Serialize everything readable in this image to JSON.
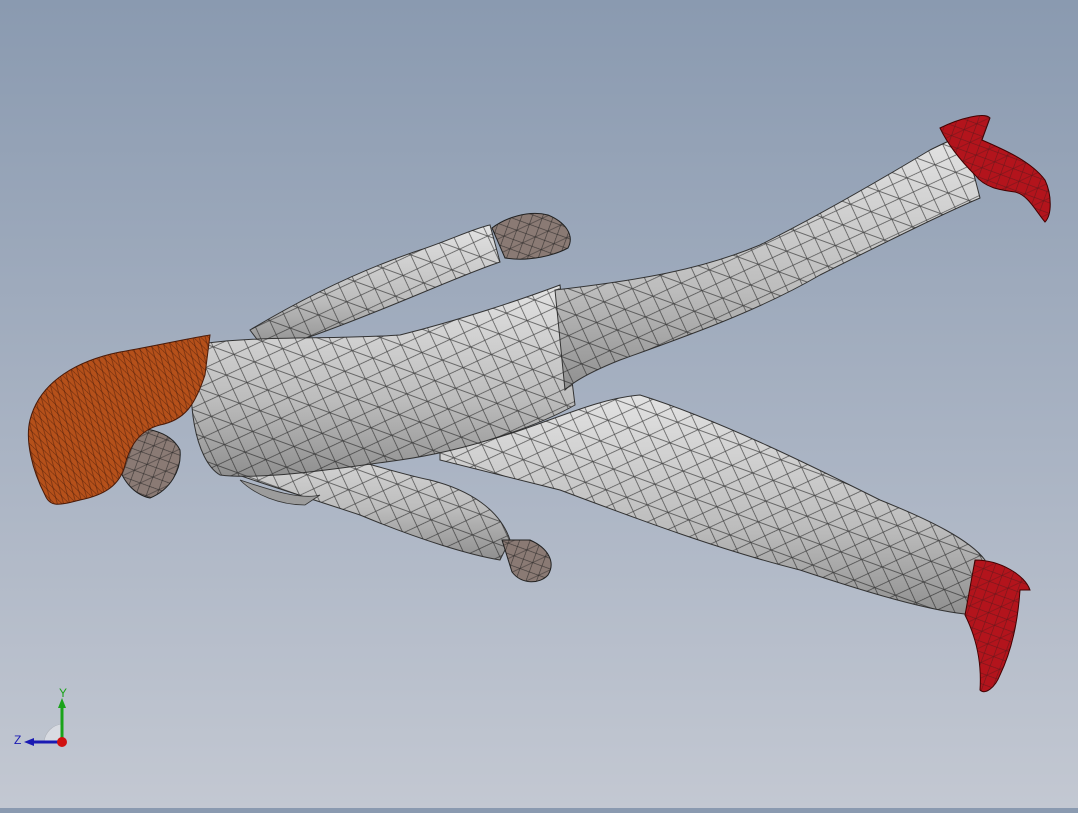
{
  "viewport": {
    "background_top": "#8a9ab0",
    "background_bottom": "#c3c8d2",
    "model": "mannequin-mesh"
  },
  "colors": {
    "suit": "#c9c9c9",
    "suit_shade": "#9c9c9c",
    "hair": "#b5501a",
    "hair_shade": "#8a3a10",
    "skin": "#8a7a74",
    "shoe": "#b3141c",
    "mesh": "#1c1c1c"
  },
  "triad": {
    "y_label": "Y",
    "z_label": "Z",
    "y_color": "#1aa31a",
    "z_color": "#1a1ab3",
    "x_color": "#d01010"
  }
}
